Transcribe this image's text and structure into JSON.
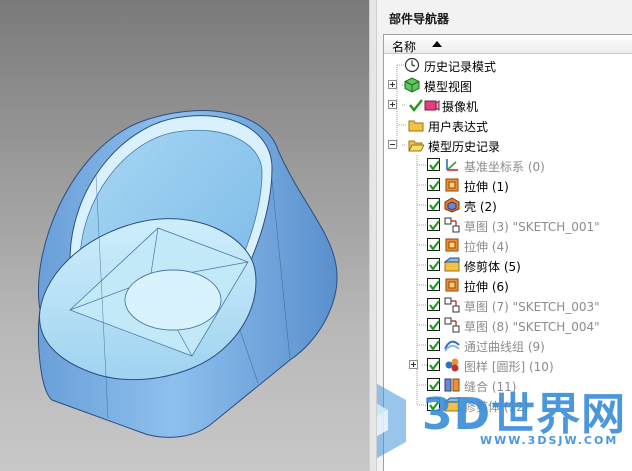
{
  "navigator": {
    "title": "部件导航器",
    "column_header": "名称"
  },
  "tree": {
    "history_mode": "历史记录模式",
    "model_views": "模型视图",
    "cameras": "摄像机",
    "user_expressions": "用户表达式",
    "model_history": "模型历史记录",
    "features": [
      {
        "label": "基准坐标系 (0)",
        "suppressed": true,
        "icon": "datum-csys-icon"
      },
      {
        "label": "拉伸 (1)",
        "suppressed": false,
        "icon": "extrude-icon"
      },
      {
        "label": "壳 (2)",
        "suppressed": false,
        "icon": "shell-icon"
      },
      {
        "label": "草图 (3) \"SKETCH_001\"",
        "suppressed": true,
        "icon": "sketch-icon"
      },
      {
        "label": "拉伸 (4)",
        "suppressed": true,
        "icon": "extrude-icon"
      },
      {
        "label": "修剪体 (5)",
        "suppressed": false,
        "icon": "trim-body-icon"
      },
      {
        "label": "拉伸 (6)",
        "suppressed": false,
        "icon": "extrude-icon"
      },
      {
        "label": "草图 (7) \"SKETCH_003\"",
        "suppressed": true,
        "icon": "sketch-icon"
      },
      {
        "label": "草图 (8) \"SKETCH_004\"",
        "suppressed": true,
        "icon": "sketch-icon"
      },
      {
        "label": "通过曲线组 (9)",
        "suppressed": true,
        "icon": "through-curves-icon"
      },
      {
        "label": "图样 [圆形] (10)",
        "suppressed": true,
        "icon": "pattern-icon"
      },
      {
        "label": "缝合 (11)",
        "suppressed": true,
        "icon": "sew-icon"
      },
      {
        "label": "修剪体 (12)",
        "suppressed": true,
        "icon": "trim-body-icon"
      }
    ]
  },
  "watermark": {
    "brand": "3D世界网",
    "url": "WWW.3DSJW.COM"
  },
  "colors": {
    "part_body": "#7fb2e8",
    "part_inner": "#b9e3f7",
    "suppressed_text": "#8c8c8c",
    "check_green": "#1e9e1e",
    "watermark_blue": "#378cd7"
  }
}
